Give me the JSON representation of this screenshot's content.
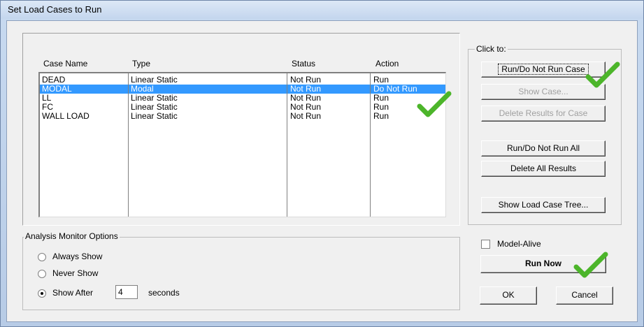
{
  "window": {
    "title": "Set Load Cases to Run"
  },
  "table": {
    "headers": [
      "Case Name",
      "Type",
      "Status",
      "Action"
    ],
    "rows": [
      {
        "name": "DEAD",
        "type": "Linear Static",
        "status": "Not Run",
        "action": "Run",
        "selected": false
      },
      {
        "name": "MODAL",
        "type": "Modal",
        "status": "Not Run",
        "action": "Do Not Run",
        "selected": true
      },
      {
        "name": "LL",
        "type": "Linear Static",
        "status": "Not Run",
        "action": "Run",
        "selected": false
      },
      {
        "name": "FC",
        "type": "Linear Static",
        "status": "Not Run",
        "action": "Run",
        "selected": false
      },
      {
        "name": "WALL LOAD",
        "type": "Linear Static",
        "status": "Not Run",
        "action": "Run",
        "selected": false
      }
    ]
  },
  "click_to": {
    "label": "Click to:",
    "run_do_not_run_case": "Run/Do Not Run Case",
    "show_case": "Show Case...",
    "delete_results_for_case": "Delete Results for Case",
    "run_do_not_run_all": "Run/Do Not Run All",
    "delete_all_results": "Delete All Results",
    "show_load_case_tree": "Show Load Case Tree..."
  },
  "monitor": {
    "label": "Analysis Monitor Options",
    "always_show": "Always Show",
    "never_show": "Never Show",
    "show_after": "Show After",
    "show_after_value": "4",
    "seconds": "seconds",
    "selected_option": "show_after"
  },
  "model_alive": {
    "label": "Model-Alive",
    "checked": false
  },
  "buttons": {
    "run_now": "Run Now",
    "ok": "OK",
    "cancel": "Cancel"
  },
  "colors": {
    "selection": "#3399ff",
    "checkmark": "#4cb52a"
  }
}
